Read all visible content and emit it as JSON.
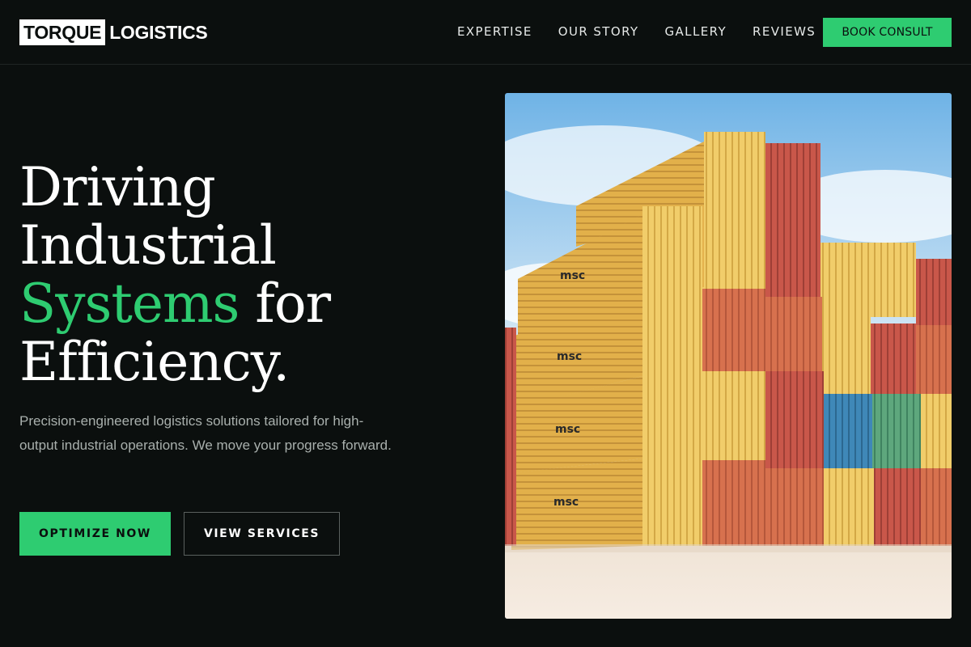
{
  "brand": {
    "logo_boxed": "TORQUE",
    "logo_rest": "LOGISTICS"
  },
  "nav": {
    "items": [
      {
        "label": "EXPERTISE"
      },
      {
        "label": "OUR STORY"
      },
      {
        "label": "GALLERY"
      },
      {
        "label": "REVIEWS"
      }
    ],
    "cta_label": "BOOK CONSULT"
  },
  "hero": {
    "headline_line1": "Driving",
    "headline_line2": "Industrial",
    "headline_accent": "Systems",
    "headline_line3_rest": " for",
    "headline_line4": "Efficiency.",
    "subtext": "Precision-engineered logistics solutions tailored for high-output industrial operations. We move your progress forward.",
    "primary_button": "OPTIMIZE NOW",
    "secondary_button": "VIEW SERVICES",
    "image_icon": "shipping-containers-photo"
  },
  "colors": {
    "background": "#0b0f0e",
    "accent": "#2ecc71",
    "text": "#ffffff",
    "muted": "#a9b0ad"
  }
}
